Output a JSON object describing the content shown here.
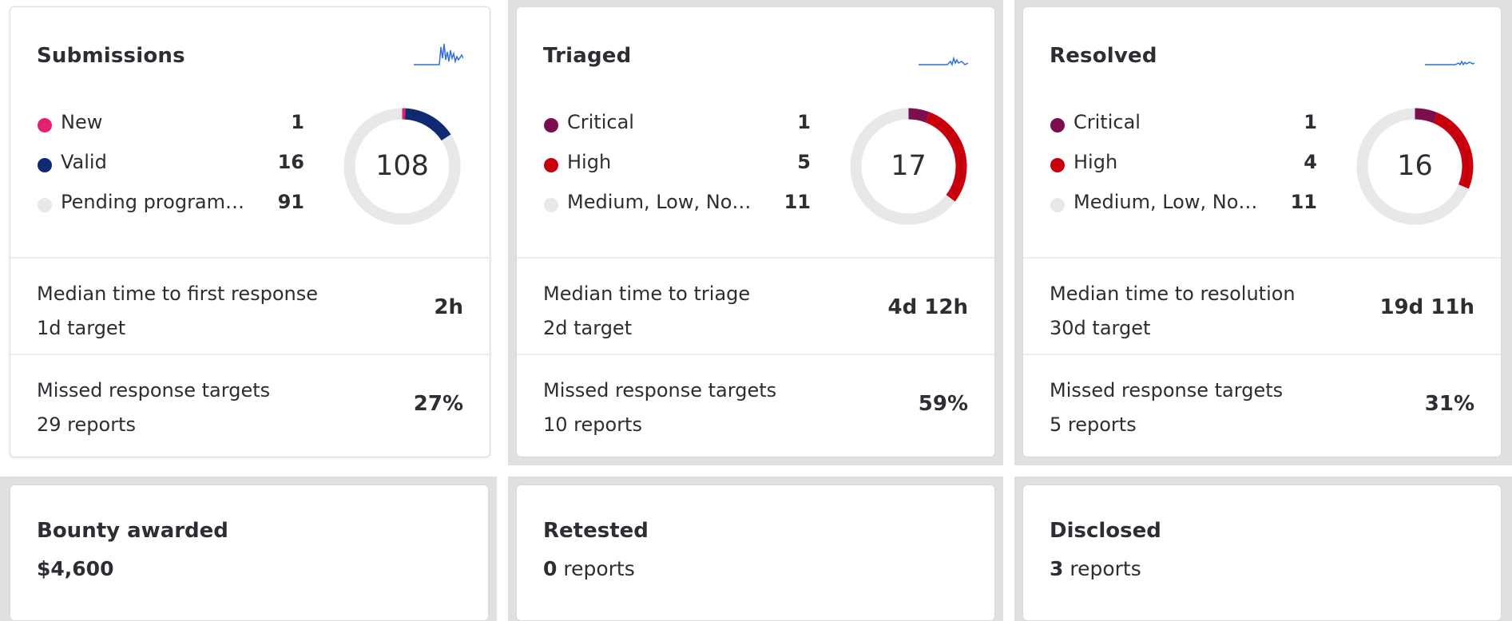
{
  "colors": {
    "pink": "#e3206f",
    "navy": "#0f2a72",
    "ring": "#e8e8e8",
    "plum": "#7b0f4e",
    "red": "#c8000e",
    "spark": "#2f6fe0"
  },
  "cards": [
    {
      "title": "Submissions",
      "total": "108",
      "legend": [
        {
          "label": "New",
          "count": "1",
          "color": "#e3206f",
          "value": 1
        },
        {
          "label": "Valid",
          "count": "16",
          "color": "#0f2a72",
          "value": 16
        },
        {
          "label": "Pending program review",
          "count": "91",
          "color": "#e8e8e8",
          "value": 91
        }
      ],
      "metric1": {
        "title": "Median time to first response",
        "sub": "1d target",
        "value": "2h"
      },
      "metric2": {
        "title": "Missed response targets",
        "sub": "29 reports",
        "value": "27%"
      }
    },
    {
      "title": "Triaged",
      "total": "17",
      "legend": [
        {
          "label": "Critical",
          "count": "1",
          "color": "#7b0f4e",
          "value": 1
        },
        {
          "label": "High",
          "count": "5",
          "color": "#c8000e",
          "value": 5
        },
        {
          "label": "Medium, Low, None",
          "count": "11",
          "color": "#e8e8e8",
          "value": 11
        }
      ],
      "metric1": {
        "title": "Median time to triage",
        "sub": "2d target",
        "value": "4d 12h"
      },
      "metric2": {
        "title": "Missed response targets",
        "sub": "10 reports",
        "value": "59%"
      }
    },
    {
      "title": "Resolved",
      "total": "16",
      "legend": [
        {
          "label": "Critical",
          "count": "1",
          "color": "#7b0f4e",
          "value": 1
        },
        {
          "label": "High",
          "count": "4",
          "color": "#c8000e",
          "value": 4
        },
        {
          "label": "Medium, Low, None",
          "count": "11",
          "color": "#e8e8e8",
          "value": 11
        }
      ],
      "metric1": {
        "title": "Median time to resolution",
        "sub": "30d target",
        "value": "19d 11h"
      },
      "metric2": {
        "title": "Missed response targets",
        "sub": "5 reports",
        "value": "31%"
      }
    }
  ],
  "stats": [
    {
      "title": "Bounty awarded",
      "value": "$4,600",
      "suffix": ""
    },
    {
      "title": "Retested",
      "value": "0",
      "suffix": "reports"
    },
    {
      "title": "Disclosed",
      "value": "3",
      "suffix": "reports"
    }
  ]
}
